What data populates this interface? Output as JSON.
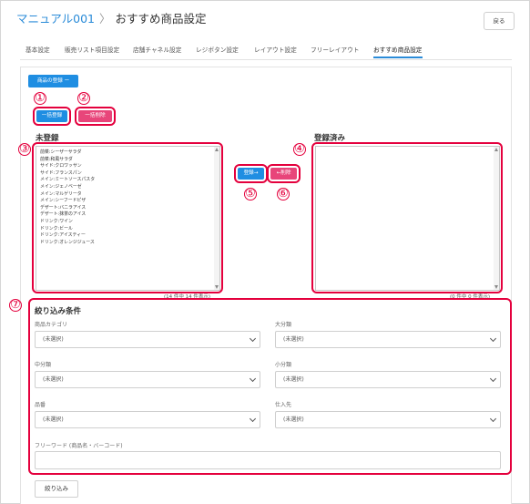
{
  "header": {
    "breadcrumb_root": "マニュアル001",
    "breadcrumb_separator": "〉",
    "page_title": "おすすめ商品設定",
    "back_label": "戻る"
  },
  "tabs": [
    {
      "label": "基本設定"
    },
    {
      "label": "販売リスト項目設定"
    },
    {
      "label": "店舗チャネル設定"
    },
    {
      "label": "レジボタン設定"
    },
    {
      "label": "レイアウト設定"
    },
    {
      "label": "フリーレイアウト"
    },
    {
      "label": "おすすめ商品設定"
    }
  ],
  "register_menu_label": "商品の登録 ー",
  "bulk_register_label": "一括登録",
  "bulk_delete_label": "一括削除",
  "unregistered": {
    "title": "未登録",
    "items": [
      "前菜:シーザーサラダ",
      "前菜:和風サラダ",
      "サイド:クロワッサン",
      "サイド:フランスパン",
      "メイン:ミートソースパスタ",
      "メイン:ジェノベーゼ",
      "メイン:マルゲリータ",
      "メイン:シーフードピザ",
      "デザート:バニラアイス",
      "デザート:抹茶のアイス",
      "ドリンク:ワイン",
      "ドリンク:ビール",
      "ドリンク:アイスティー",
      "ドリンク:オレンジジュース"
    ],
    "count_text": "(14 件中 14 件表示)"
  },
  "registered": {
    "title": "登録済み",
    "count_text": "(0 件中 0 件表示)"
  },
  "move_register_label": "登録→",
  "move_delete_label": "←削除",
  "annotations": [
    "①",
    "②",
    "③",
    "④",
    "⑤",
    "⑥",
    "⑦"
  ],
  "filter": {
    "title": "絞り込み条件",
    "fields": [
      {
        "label": "商品カテゴリ",
        "value": "(未選択)"
      },
      {
        "label": "大分類",
        "value": "(未選択)"
      },
      {
        "label": "中分類",
        "value": "(未選択)"
      },
      {
        "label": "小分類",
        "value": "(未選択)"
      },
      {
        "label": "品番",
        "value": "(未選択)"
      },
      {
        "label": "仕入先",
        "value": "(未選択)"
      }
    ],
    "freeword_label": "フリーワード (商品名・バーコード)",
    "freeword_value": "",
    "apply_label": "絞り込み"
  },
  "colors": {
    "accent": "#1f8ee2",
    "delete": "#e8457a",
    "highlight": "#e4003d",
    "link": "#2a8bd8"
  }
}
